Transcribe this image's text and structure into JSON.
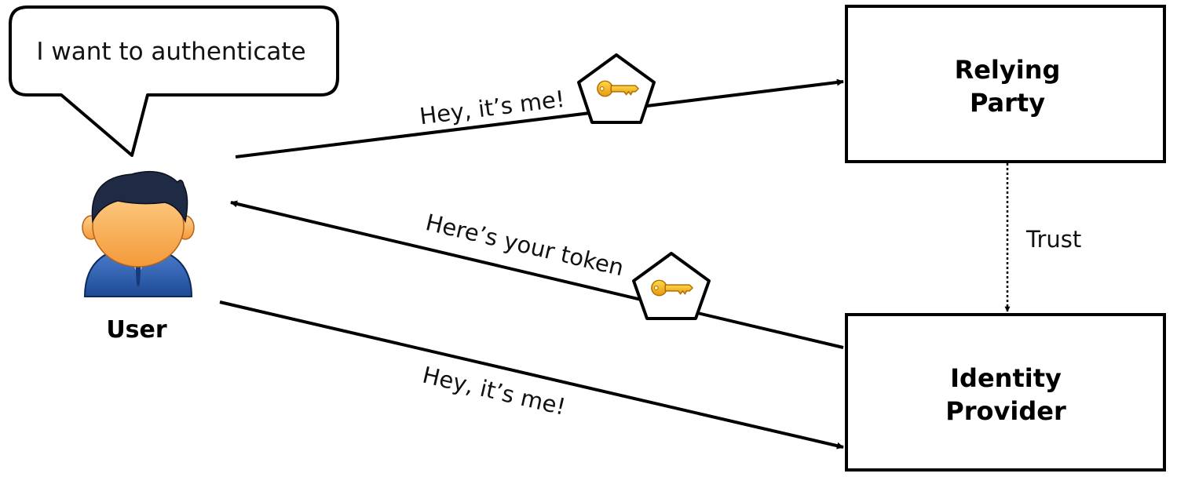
{
  "speech_bubble": {
    "text": "I want to authenticate"
  },
  "user": {
    "label": "User"
  },
  "relying_party": {
    "line1": "Relying",
    "line2": "Party"
  },
  "identity_provider": {
    "line1": "Identity",
    "line2": "Provider"
  },
  "arrows": {
    "user_to_rp": {
      "label": "Hey, it’s me!"
    },
    "idp_to_user": {
      "label": "Here’s your token"
    },
    "user_to_idp": {
      "label": "Hey, it’s me!"
    },
    "rp_to_idp": {
      "label": "Trust"
    }
  },
  "icons": {
    "token_1": "key-token-icon",
    "token_2": "key-token-icon",
    "user_avatar": "user-avatar-icon"
  },
  "colors": {
    "stroke": "#000000",
    "key_gold": "#f2b51c",
    "skin": "#f7a84a",
    "hair": "#1f2a44",
    "suit": "#2b5aa8"
  }
}
